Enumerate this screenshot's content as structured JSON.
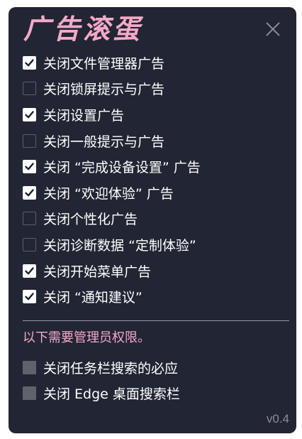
{
  "app": {
    "title": "广告滚蛋",
    "version": "v0.4"
  },
  "colors": {
    "background": "#222533",
    "accent_pink": "#f4a9c9",
    "text": "#ffffff",
    "muted": "#8a8c95"
  },
  "options": [
    {
      "label": "关闭文件管理器广告",
      "checked": true
    },
    {
      "label": "关闭锁屏提示与广告",
      "checked": false
    },
    {
      "label": "关闭设置广告",
      "checked": true
    },
    {
      "label": "关闭一般提示与广告",
      "checked": false
    },
    {
      "label": "关闭 “完成设备设置” 广告",
      "checked": true
    },
    {
      "label": "关闭 “欢迎体验” 广告",
      "checked": true
    },
    {
      "label": "关闭个性化广告",
      "checked": false
    },
    {
      "label": "关闭诊断数据 “定制体验”",
      "checked": false
    },
    {
      "label": "关闭开始菜单广告",
      "checked": true
    },
    {
      "label": "关闭 “通知建议”",
      "checked": true
    }
  ],
  "admin": {
    "note": "以下需要管理员权限。",
    "options": [
      {
        "label": "关闭任务栏搜索的必应",
        "enabled": false
      },
      {
        "label": "关闭 Edge 桌面搜索栏",
        "enabled": false
      }
    ]
  }
}
